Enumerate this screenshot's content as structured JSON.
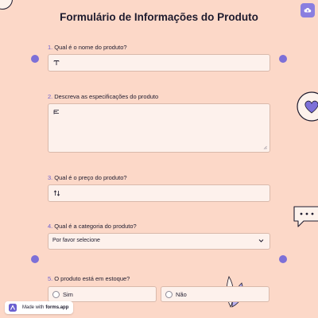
{
  "form": {
    "title": "Formulário de Informações do Produto"
  },
  "questions": [
    {
      "number": "1.",
      "label": "Qual é o nome do produto?",
      "type": "short-text"
    },
    {
      "number": "2.",
      "label": "Descreva as especificações do produto",
      "type": "long-text"
    },
    {
      "number": "3.",
      "label": "Qual é o preço do produto?",
      "type": "number"
    },
    {
      "number": "4.",
      "label": "Qual é a categoria do produto?",
      "type": "select",
      "selected": "Por favor selecione"
    },
    {
      "number": "5.",
      "label": "O produto está em estoque?",
      "type": "radio",
      "options": [
        "Sim",
        "Não"
      ]
    }
  ],
  "badge": {
    "prefix": "Made with",
    "brand": "forms.app"
  },
  "colors": {
    "background": "#fcd8c8",
    "accent": "#7d70d8",
    "field_bg": "#fdf1ec",
    "field_border": "#d9b9ab"
  },
  "icons": [
    "cloud-upload-icon",
    "text-icon",
    "paragraph-icon",
    "number-icon",
    "chevron-down-icon",
    "heart-icon",
    "chat-bubble-icon",
    "leaf-icon",
    "forms-app-logo-icon"
  ]
}
